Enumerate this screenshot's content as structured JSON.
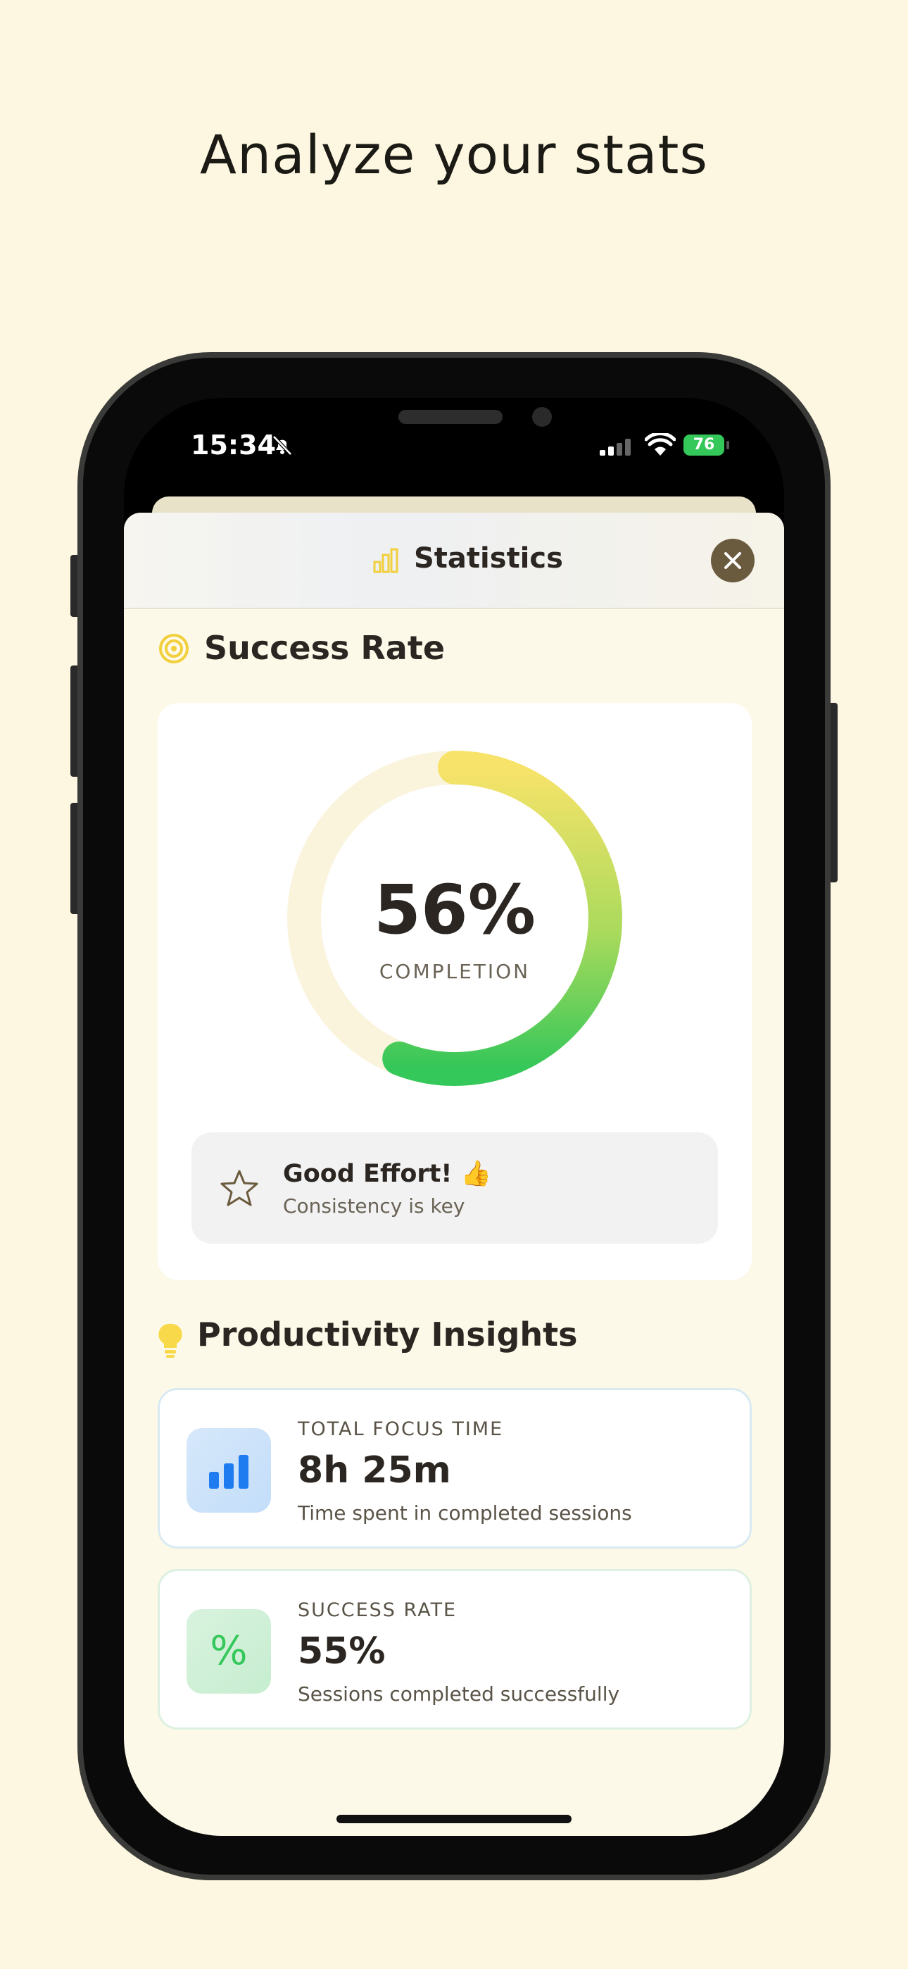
{
  "headline": "Analyze your stats",
  "status_bar": {
    "time": "15:34",
    "battery": "76"
  },
  "sheet": {
    "title": "Statistics",
    "title_icon": "bar-chart-icon",
    "close_icon": "close-icon"
  },
  "success_rate": {
    "section_title": "Success Rate",
    "section_icon": "target-icon",
    "percent_text": "56%",
    "completion_fraction": 0.56,
    "label": "COMPLETION",
    "effort_title": "Good Effort! 👍",
    "effort_subtitle": "Consistency is key"
  },
  "insights": {
    "section_title": "Productivity Insights",
    "section_icon": "lightbulb-icon",
    "items": [
      {
        "label": "TOTAL FOCUS TIME",
        "value": "8h 25m",
        "description": "Time spent in completed sessions",
        "icon": "bar-chart-icon"
      },
      {
        "label": "SUCCESS RATE",
        "value": "55%",
        "description": "Sessions completed successfully",
        "icon": "percent-icon",
        "icon_glyph": "%"
      }
    ]
  },
  "colors": {
    "accent_yellow": "#F5D84A",
    "accent_green": "#34C759",
    "close_bg": "#6B5B3E",
    "background": "#FDF7E1"
  }
}
